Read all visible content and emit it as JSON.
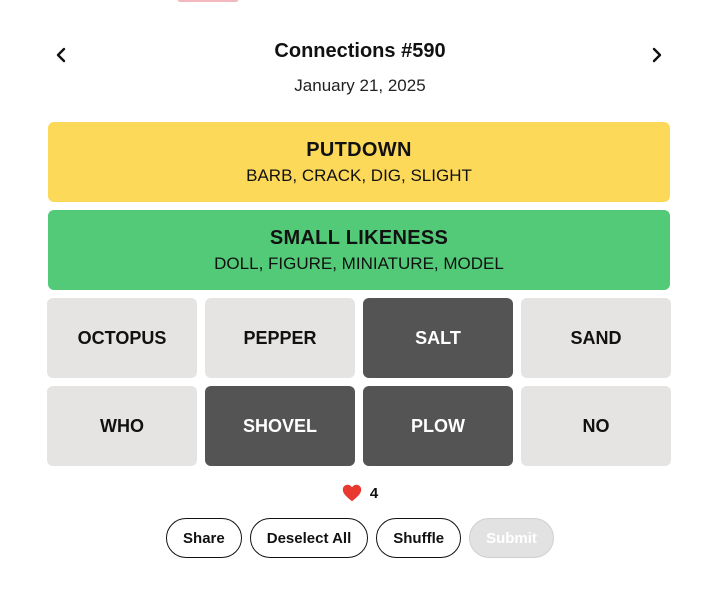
{
  "header": {
    "title": "Connections #590",
    "date": "January 21, 2025",
    "prev_icon": "chevron-left-icon",
    "next_icon": "chevron-right-icon"
  },
  "solved_groups": [
    {
      "name": "PUTDOWN",
      "words": "BARB, CRACK, DIG, SLIGHT",
      "color": "#fdd95a"
    },
    {
      "name": "SMALL LIKENESS",
      "words": "DOLL, FIGURE, MINIATURE, MODEL",
      "color": "#52ca78"
    }
  ],
  "tiles": [
    {
      "word": "OCTOPUS",
      "selected": false
    },
    {
      "word": "PEPPER",
      "selected": false
    },
    {
      "word": "SALT",
      "selected": true
    },
    {
      "word": "SAND",
      "selected": false
    },
    {
      "word": "WHO",
      "selected": false
    },
    {
      "word": "SHOVEL",
      "selected": true
    },
    {
      "word": "PLOW",
      "selected": true
    },
    {
      "word": "NO",
      "selected": false
    }
  ],
  "tile_colors": {
    "default_bg": "#e5e4e2",
    "default_text": "#111111",
    "selected_bg": "#545454",
    "selected_text": "#ffffff"
  },
  "mistakes": {
    "icon": "heart-icon",
    "count": "4",
    "color": "#e8382f"
  },
  "controls": {
    "share_label": "Share",
    "deselect_label": "Deselect All",
    "shuffle_label": "Shuffle",
    "submit_label": "Submit",
    "submit_enabled": false
  }
}
